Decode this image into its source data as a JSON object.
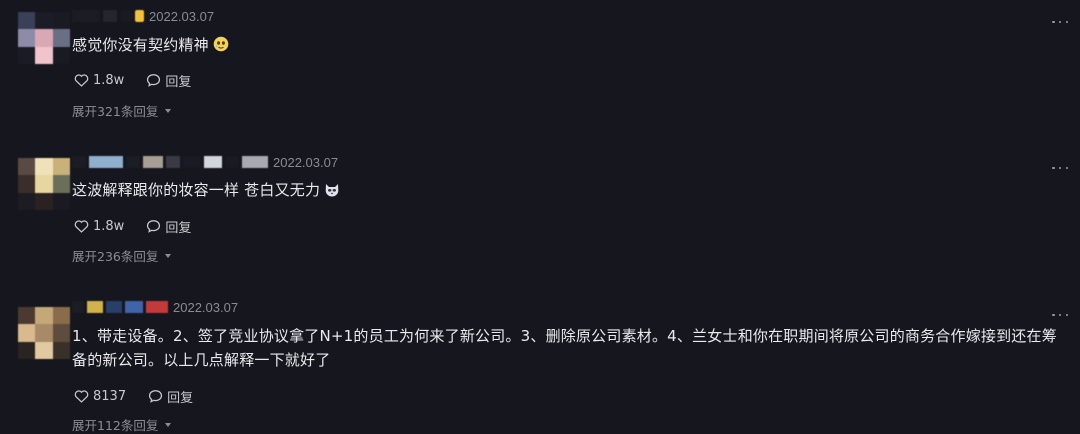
{
  "comments": [
    {
      "date": "2022.03.07",
      "text": "感觉你没有契约精神",
      "emoji_icon": "smiling-face-with-tear-icon",
      "likes": "1.8w",
      "reply_label": "回复",
      "replies_label": "展开321条回复"
    },
    {
      "date": "2022.03.07",
      "text": "这波解释跟你的妆容一样 苍白又无力",
      "emoji_icon": "cat-face-icon",
      "likes": "1.8w",
      "reply_label": "回复",
      "replies_label": "展开236条回复"
    },
    {
      "date": "2022.03.07",
      "text": "1、带走设备。2、签了竞业协议拿了N+1的员工为何来了新公司。3、删除原公司素材。4、兰女士和你在职期间将原公司的商务合作嫁接到还在筹备的新公司。以上几点解释一下就好了",
      "likes": "8137",
      "reply_label": "回复",
      "replies_label": "展开112条回复"
    }
  ],
  "colors": {
    "background": "#16161e",
    "text": "#e9e9ee",
    "muted": "#8c8c94"
  }
}
